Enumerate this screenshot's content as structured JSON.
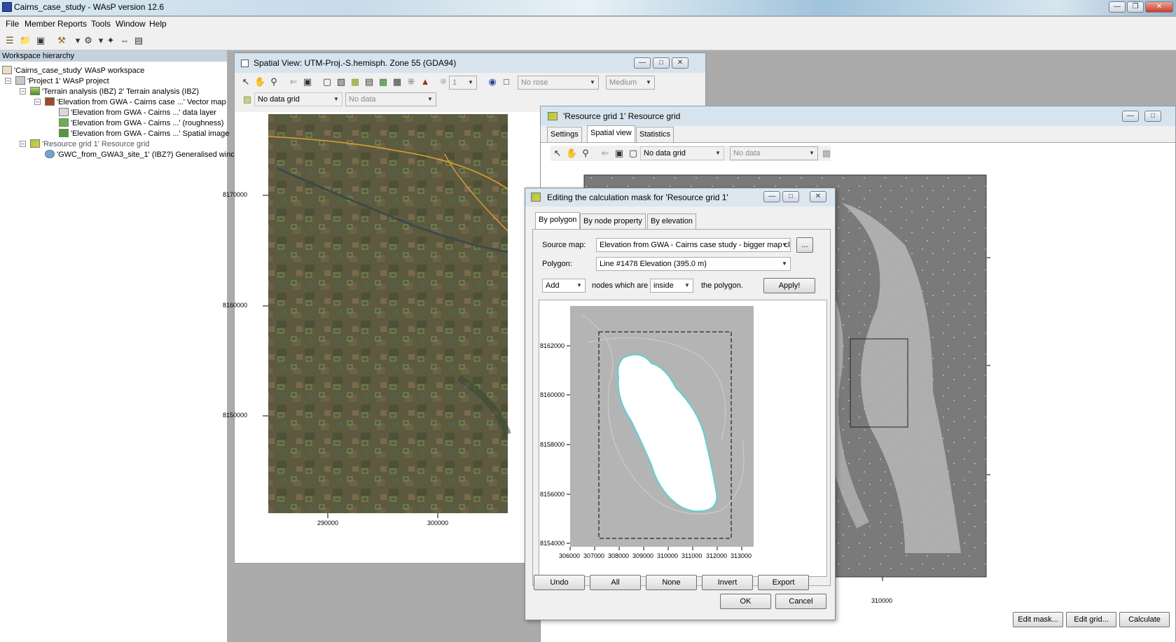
{
  "app": {
    "title": "Cairns_case_study - WAsP version 12.6",
    "caption_buttons": [
      "minimize",
      "restore",
      "close"
    ]
  },
  "menu": [
    "File",
    "Member",
    "Reports",
    "Tools",
    "Window",
    "Help"
  ],
  "workspace": {
    "header": "Workspace hierarchy",
    "tree": [
      {
        "label": "'Cairns_case_study' WAsP workspace",
        "icon": "workspace-icon"
      },
      {
        "label": "'Project 1' WAsP project",
        "icon": "project-icon"
      },
      {
        "label": "'Terrain analysis (IBZ) 2' Terrain analysis (IBZ)",
        "icon": "terrain-icon"
      },
      {
        "label": "'Elevation from GWA - Cairns case ...' Vector map",
        "icon": "vector-map-icon"
      },
      {
        "label": "'Elevation from GWA - Cairns ...' data layer",
        "icon": "data-layer-icon"
      },
      {
        "label": "'Elevation from GWA - Cairns ...' (roughness)",
        "icon": "roughness-icon"
      },
      {
        "label": "'Elevation from GWA - Cairns ...' Spatial image",
        "icon": "spatial-image-icon"
      },
      {
        "label": "'Resource grid 1' Resource grid",
        "icon": "resource-grid-icon"
      },
      {
        "label": "'GWC_from_GWA3_site_1' (IBZ?) Generalised wind",
        "icon": "generalised-wind-icon"
      }
    ]
  },
  "spatial_view": {
    "title": "Spatial View: UTM-Proj.-S.hemisph. Zone 55 (GDA94)",
    "rose_combo": "No rose",
    "size_combo": "Medium",
    "count_combo": "1",
    "grid_combo": "No data grid",
    "data_combo": "No data",
    "y_ticks": [
      "8170000",
      "8160000",
      "8150000"
    ],
    "x_ticks": [
      "290000",
      "300000"
    ]
  },
  "resource_grid": {
    "title": "'Resource grid 1' Resource grid",
    "tabs": [
      "Settings",
      "Spatial view",
      "Statistics"
    ],
    "grid_combo": "No data grid",
    "data_combo": "No data",
    "x_tick": "310000",
    "buttons": [
      "Edit mask...",
      "Edit grid...",
      "Calculate"
    ]
  },
  "dialog": {
    "title": "Editing the calculation mask for 'Resource grid 1'",
    "tabs": [
      "By polygon",
      "By node property",
      "By elevation"
    ],
    "source_map_label": "Source map:",
    "source_map_value": "Elevation from GWA - Cairns case study - bigger map cl",
    "browse_button": "...",
    "polygon_label": "Polygon:",
    "polygon_value": "Line #1478 Elevation (395.0 m)",
    "mode_value": "Add",
    "nodes_text": "nodes which are",
    "where_value": "inside",
    "polygon_text": "the polygon.",
    "apply_button": "Apply!",
    "y_ticks": [
      "8162000",
      "8160000",
      "8158000",
      "8156000",
      "8154000"
    ],
    "x_ticks": [
      "306000",
      "307000",
      "308000",
      "309000",
      "310000",
      "311000",
      "312000",
      "313000"
    ],
    "action_buttons": [
      "Undo",
      "All",
      "None",
      "Invert",
      "Export"
    ],
    "ok_button": "OK",
    "cancel_button": "Cancel"
  },
  "colors": {
    "accent_title": "#d7e4ee",
    "polygon_outline": "#5fd1d6",
    "window_bg": "#f0f0f0"
  }
}
